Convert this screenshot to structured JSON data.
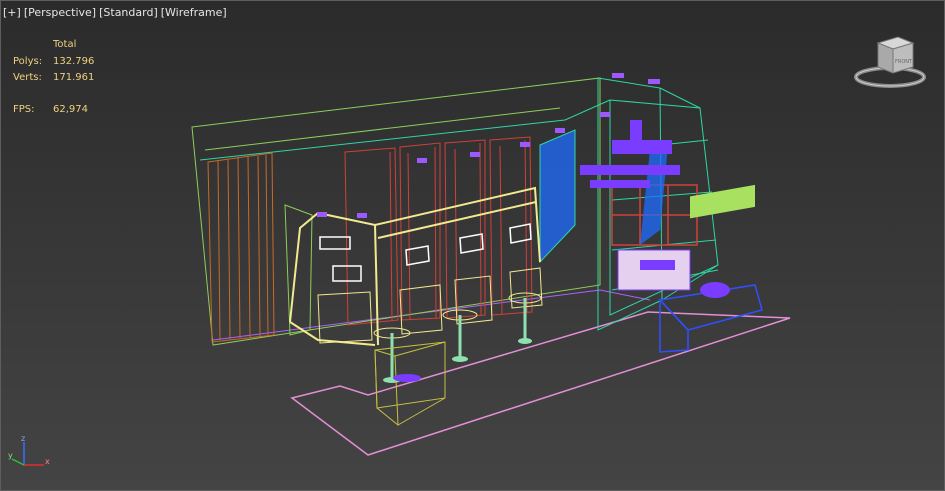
{
  "viewport": {
    "menu": {
      "plus": "[+]",
      "view": "[Perspective]",
      "shading_mode": "[Standard]",
      "display_style": "[Wireframe]"
    },
    "stats": {
      "header": "Total",
      "polys_label": "Polys:",
      "polys_value": "132.796",
      "verts_label": "Verts:",
      "verts_value": "171.961",
      "fps_label": "FPS:",
      "fps_value": "62,974"
    },
    "viewcube": {
      "face_label": "FRONT",
      "icon": "viewcube-icon"
    },
    "axis": {
      "x": "x",
      "y": "y",
      "z": "z"
    }
  },
  "colors": {
    "background": "#3a3a3a",
    "stats_text": "#f0d080",
    "menu_text": "#e6e6e6",
    "wire_green": "#8ccf5a",
    "wire_cyan": "#2fd6a4",
    "wire_red": "#d0403a",
    "wire_orange": "#c86a2a",
    "wire_yellow": "#f2ea90",
    "wire_pink": "#e38fd6",
    "wire_purple": "#7a3cff",
    "wire_blue": "#1e6cff"
  }
}
